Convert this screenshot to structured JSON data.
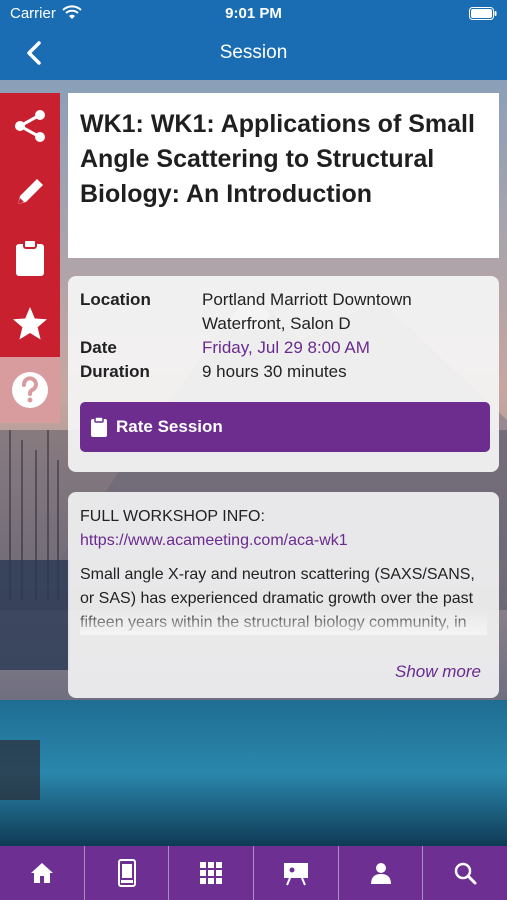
{
  "status_bar": {
    "carrier": "Carrier",
    "time": "9:01 PM"
  },
  "nav": {
    "title": "Session",
    "back_icon": "chevron-left-icon"
  },
  "action_rail": {
    "items": [
      {
        "icon": "share-icon"
      },
      {
        "icon": "pencil-icon"
      },
      {
        "icon": "clipboard-icon"
      },
      {
        "icon": "star-icon"
      },
      {
        "icon": "question-icon"
      }
    ],
    "color": "#c8202f"
  },
  "session": {
    "title": "WK1: WK1: Applications of Small Angle Scattering to Structural Biology: An Introduction",
    "location_label": "Location",
    "location_value": "Portland Marriott Downtown Waterfront, Salon D",
    "date_label": "Date",
    "date_value": "Friday, Jul 29 8:00 AM",
    "duration_label": "Duration",
    "duration_value": "9 hours 30 minutes",
    "rate_button": "Rate Session"
  },
  "description": {
    "heading": "FULL WORKSHOP INFO:",
    "link": "https://www.acameeting.com/aca-wk1",
    "text": "Small angle X-ray and neutron scattering (SAXS/SANS, or SAS) has experienced dramatic growth over the past fifteen years within the structural biology community, in part...",
    "show_more": "Show more"
  },
  "tab_bar": {
    "items": [
      "home-icon",
      "mobile-device-icon",
      "grid-icon",
      "presentation-icon",
      "person-icon",
      "search-icon"
    ],
    "color": "#6d2f91"
  }
}
